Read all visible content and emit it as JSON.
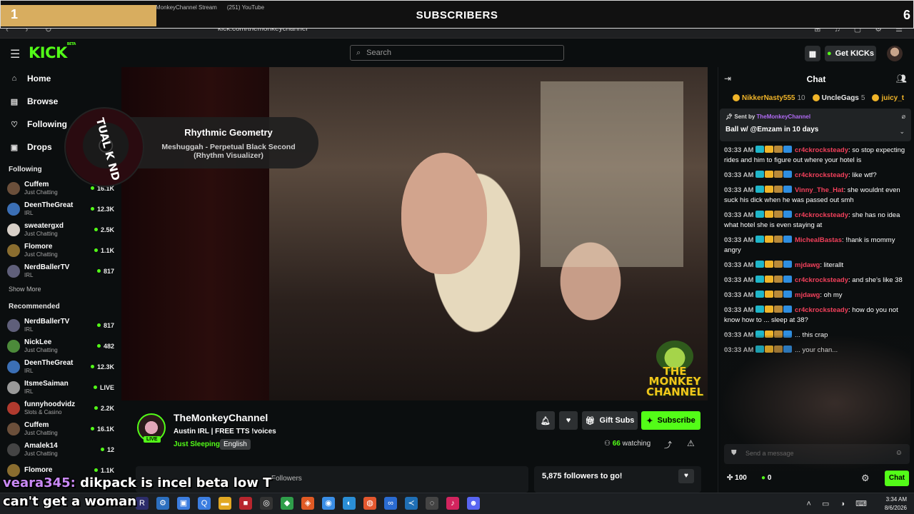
{
  "overlay": {
    "left_count": "1",
    "title": "SUBSCRIBERS",
    "right_count": "6"
  },
  "browser": {
    "tabs": [
      "MonkeyChannel Stream",
      "(251) YouTube"
    ],
    "url": "kick.com/themonkeychannel"
  },
  "header": {
    "logo": "KICK",
    "logo_sup": "BETA",
    "search_placeholder": "Search",
    "get_kicks_label": "Get KICKs"
  },
  "sidebar": {
    "nav": [
      {
        "label": "Home",
        "icon": "home-icon"
      },
      {
        "label": "Browse",
        "icon": "browse-icon"
      },
      {
        "label": "Following",
        "icon": "heart-icon"
      },
      {
        "label": "Drops",
        "icon": "drops-icon"
      }
    ],
    "following_title": "Following",
    "following": [
      {
        "name": "Cuffem",
        "category": "Just Chatting",
        "viewers": "16.1K",
        "color": "#6b4f3a"
      },
      {
        "name": "DeenTheGreat",
        "category": "IRL",
        "viewers": "12.3K",
        "color": "#3b6fb5"
      },
      {
        "name": "sweatergxd",
        "category": "Just Chatting",
        "viewers": "2.5K",
        "color": "#d8d0c8"
      },
      {
        "name": "Flomore",
        "category": "Just Chatting",
        "viewers": "1.1K",
        "color": "#8a6d2f"
      },
      {
        "name": "NerdBallerTV",
        "category": "IRL",
        "viewers": "817",
        "color": "#5f5f7a"
      }
    ],
    "show_more": "Show More",
    "recommended_title": "Recommended",
    "recommended": [
      {
        "name": "NerdBallerTV",
        "category": "IRL",
        "viewers": "817",
        "color": "#5f5f7a"
      },
      {
        "name": "NickLee",
        "category": "Just Chatting",
        "viewers": "482",
        "color": "#4c8a3a"
      },
      {
        "name": "DeenTheGreat",
        "category": "IRL",
        "viewers": "12.3K",
        "color": "#3b6fb5"
      },
      {
        "name": "ItsmeSaiman",
        "category": "IRL",
        "viewers": "LIVE",
        "color": "#999999"
      },
      {
        "name": "funnyhoodvidz",
        "category": "Slots & Casino",
        "viewers": "2.2K",
        "color": "#b03a2e"
      },
      {
        "name": "Cuffem",
        "category": "Just Chatting",
        "viewers": "16.1K",
        "color": "#6b4f3a"
      },
      {
        "name": "Amalek14",
        "category": "Just Chatting",
        "viewers": "12",
        "color": "#444444"
      },
      {
        "name": "Flomore",
        "category": "",
        "viewers": "1.1K",
        "color": "#8a6d2f"
      }
    ]
  },
  "now_playing": {
    "song": "Rhythmic Geometry",
    "artist": "Meshuggah - Perpetual Black Second (Rhythm Visualizer)",
    "disc_text": "TUAL K ND"
  },
  "player": {
    "watermark": "THE MONKEY CHANNEL"
  },
  "stream": {
    "streamer": "TheMonkeyChannel",
    "title": "Austin IRL | FREE TTS !voices",
    "category": "Just Sleeping",
    "language": "English",
    "live_label": "LIVE",
    "gift_subs_label": "Gift Subs",
    "subscribe_label": "Subscribe",
    "watching_count": "66",
    "watching_label": "watching",
    "card_a_text": "Followers",
    "followers_goal": "5,875 followers to go!"
  },
  "chat": {
    "title": "Chat",
    "gifters": [
      {
        "name": "NikkerNasty555",
        "count": "10",
        "color": "#f0b429"
      },
      {
        "name": "UncleGags",
        "count": "5",
        "color": "#e6e6e6"
      },
      {
        "name": "juicy_t",
        "count": "",
        "color": "#f0b429"
      }
    ],
    "pinned": {
      "sent_by": "Sent by",
      "user": "TheMonkeyChannel",
      "message": "Ball w/ @Emzam in 10 days"
    },
    "messages": [
      {
        "time": "03:33 AM",
        "user": "cr4ckrocksteady",
        "color": "#f2405b",
        "text": "so stop expecting rides and him to figure out where your hotel is"
      },
      {
        "time": "03:33 AM",
        "user": "cr4ckrocksteady",
        "color": "#f2405b",
        "text": "like wtf?"
      },
      {
        "time": "03:33 AM",
        "user": "Vinny_The_Hat",
        "color": "#f2405b",
        "text": "she wouldnt even suck his dick when he was passed out smh"
      },
      {
        "time": "03:33 AM",
        "user": "cr4ckrocksteady",
        "color": "#f2405b",
        "text": "she has no idea what hotel she is even staying at"
      },
      {
        "time": "03:33 AM",
        "user": "MichealBastas",
        "color": "#f2405b",
        "text": "!hank is mommy angry"
      },
      {
        "time": "03:33 AM",
        "user": "mjdawg",
        "color": "#f2405b",
        "text": "literallt"
      },
      {
        "time": "03:33 AM",
        "user": "cr4ckrocksteady",
        "color": "#f2405b",
        "text": "and she's like 38"
      },
      {
        "time": "03:33 AM",
        "user": "mjdawg",
        "color": "#f2405b",
        "text": "oh my"
      },
      {
        "time": "03:33 AM",
        "user": "cr4ckrocksteady",
        "color": "#f2405b",
        "text": "how do you not know how to ... sleep at 38?"
      },
      {
        "time": "03:33 AM",
        "user": "",
        "color": "#f2405b",
        "text": "... this crap"
      },
      {
        "time": "03:33 AM",
        "user": "",
        "color": "#f2405b",
        "text": "... your chan..."
      }
    ],
    "input_placeholder": "Send a message",
    "points": "100",
    "kicks": "0",
    "chat_button": "Chat"
  },
  "caption": {
    "user": "veara345:",
    "text": "dikpack is incel beta low T can't get a woman"
  },
  "taskbar": {
    "time": "3:34 AM",
    "date": "8/6/2026"
  },
  "colors": {
    "accent": "#53fc18",
    "bg": "#0b0e0f",
    "overlay_gold": "#d8ad5f"
  }
}
